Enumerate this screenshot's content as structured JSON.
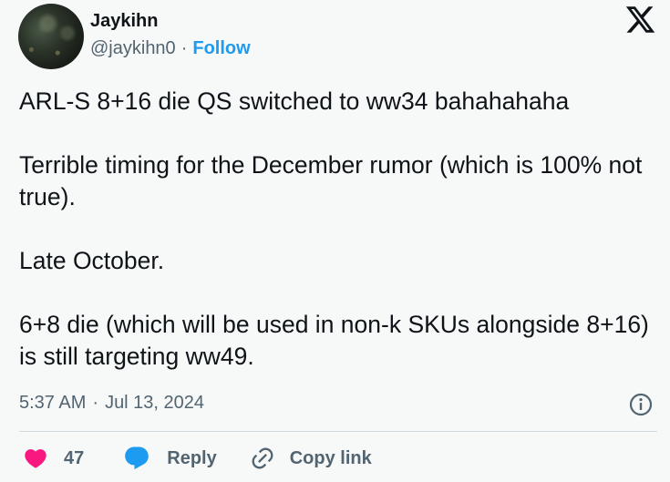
{
  "author": {
    "name": "Jaykihn",
    "handle": "@jaykihn0",
    "separator": "·",
    "follow_label": "Follow"
  },
  "tweet": {
    "paragraphs": [
      "ARL-S 8+16 die QS switched to ww34 bahahahaha",
      "Terrible timing for the December rumor (which is 100% not true).",
      "Late October.",
      "6+8 die (which will be used in non-k SKUs alongside 8+16) is still targeting ww49."
    ]
  },
  "meta": {
    "time": "5:37 AM",
    "separator": "·",
    "date": "Jul 13, 2024"
  },
  "actions": {
    "like_count": "47",
    "reply_label": "Reply",
    "copy_link_label": "Copy link"
  },
  "colors": {
    "accent": "#1d9bf0",
    "like": "#f91880",
    "muted_text": "#536471",
    "background": "#f7f9f9"
  },
  "icons": {
    "logo": "x-logo-icon",
    "info": "info-icon",
    "like": "heart-icon",
    "reply": "reply-bubble-icon",
    "copy_link": "link-icon"
  }
}
